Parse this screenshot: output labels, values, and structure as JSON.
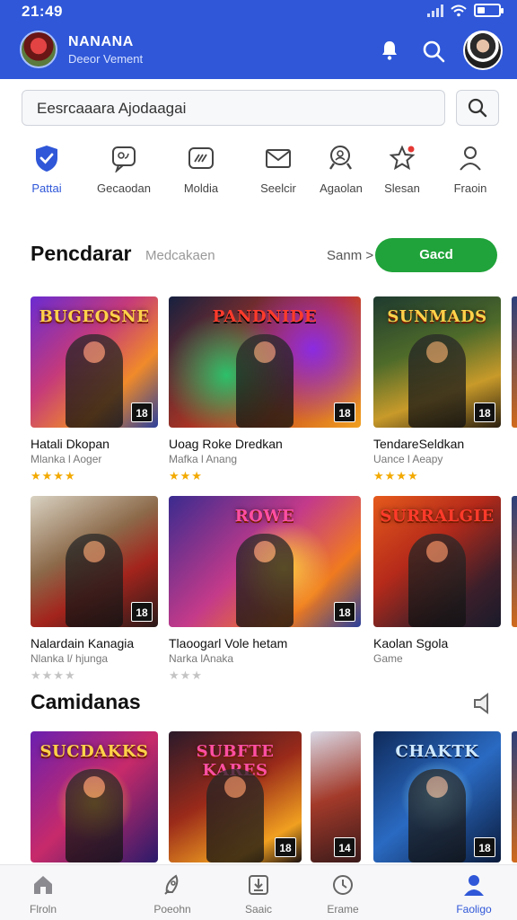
{
  "status": {
    "time": "21:49"
  },
  "header": {
    "app_name": "NANANA",
    "app_subtitle": "Deeor Vement"
  },
  "search": {
    "placeholder": "Eesrcaaara Ajodaagai"
  },
  "categories": [
    {
      "label": "Pattai",
      "icon": "shield-check-icon"
    },
    {
      "label": "Gecaodan",
      "icon": "chat-icon"
    },
    {
      "label": "Moldia",
      "icon": "gamepad-icon"
    },
    {
      "label": "Seelcir",
      "icon": "mail-icon"
    },
    {
      "label": "Agaolan",
      "icon": "search-user-icon"
    },
    {
      "label": "Slesan",
      "icon": "star-icon"
    },
    {
      "label": "Fraoin",
      "icon": "person-icon"
    }
  ],
  "section1": {
    "title": "Pencdarar",
    "subtitle": "Medcakaen",
    "see_all": "Sanm >",
    "button": "Gacd",
    "row1": [
      {
        "title": "Hatali Dkopan",
        "developer": "Mlanka l Aoger",
        "stars": "★★★★",
        "age": "18",
        "art_title": "BUGEOSNE"
      },
      {
        "title": "Uoag Roke Dredkan",
        "developer": "Mafka l Anang",
        "stars": "★★★",
        "age": "18",
        "art_title": "PANDNIDE"
      },
      {
        "title": "TendareSeldkan",
        "developer": "Uance l Aeapy",
        "stars": "★★★★",
        "age": "18",
        "art_title": "SUNMADS"
      }
    ],
    "row2": [
      {
        "title": "Nalardain Kanagia",
        "developer": "Nlanka l/ hjunga",
        "stars": "★★★★",
        "age": "18",
        "art_title": ""
      },
      {
        "title": "Tlaoogarl Vole hetam",
        "developer": "Narka lAnaka",
        "stars": "★★★",
        "age": "18",
        "art_title": "ROWE"
      },
      {
        "title": "Kaolan Sgola",
        "developer": "Game",
        "stars": "",
        "age": "",
        "art_title": "SURRALGIE"
      }
    ]
  },
  "section2": {
    "title": "Camidanas",
    "cards": [
      {
        "age": "",
        "art_title": "SUCDAKKS"
      },
      {
        "age": "18",
        "art_title": "SUBFTE KARES"
      },
      {
        "age": "14",
        "art_title": ""
      },
      {
        "age": "18",
        "art_title": "CHAKTK"
      }
    ]
  },
  "bottom_nav": [
    {
      "label": "Flroln",
      "icon": "home-icon"
    },
    {
      "label": "Poeohn",
      "icon": "rocket-icon"
    },
    {
      "label": "Saaic",
      "icon": "download-icon"
    },
    {
      "label": "Erame",
      "icon": "clock-icon"
    },
    {
      "label": "Faoligo",
      "icon": "profile-icon"
    }
  ],
  "colors": {
    "primary": "#2f57d8",
    "accent_green": "#20a33a",
    "star": "#f2a900"
  }
}
